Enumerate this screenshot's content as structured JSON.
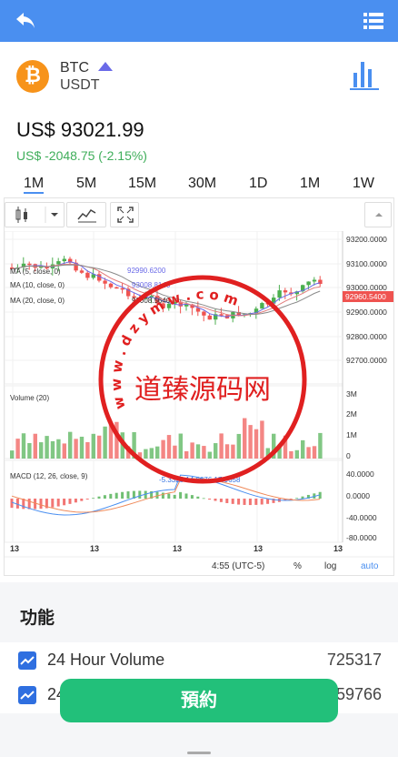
{
  "header": {
    "back_icon": "back-arrow-icon",
    "menu_icon": "list-icon",
    "color": "#4a8ff0"
  },
  "coin": {
    "logo": "₿",
    "symbol": "BTC",
    "quote": "USDT",
    "chart_icon": "bar-chart-icon"
  },
  "price": {
    "value": "US$ 93021.99",
    "change": "US$ -2048.75 (-2.15%)",
    "change_color": "#3fae5a"
  },
  "tabs": {
    "items": [
      "1M",
      "5M",
      "15M",
      "30M",
      "1D",
      "1M",
      "1W"
    ],
    "active": "1M"
  },
  "chart": {
    "price_axis": [
      "93200.0000",
      "93100.0000",
      "93000.0000",
      "92900.0000",
      "92800.0000",
      "92700.0000"
    ],
    "last_price": "92960.5400",
    "legend_ma5_value": "92990.6200",
    "legend_ma10_value": "93008.8140",
    "legend_ma20_value": "93008.5640",
    "legend_ma5": "MA (5, close, 0)",
    "legend_ma10": "MA (10, close, 0)",
    "legend_ma20": "MA (20, close, 0)",
    "volume_label": "Volume (20)",
    "volume_axis": [
      "3M",
      "2M",
      "1M",
      "0"
    ],
    "macd_label": "MACD (12, 26, close, 9)",
    "macd_values": "-5.3323  14.6676  17.9658",
    "macd_axis": [
      "40.0000",
      "0.0000",
      "-40.0000",
      "-80.0000"
    ],
    "time_ticks": [
      "13",
      "13",
      "13",
      "13",
      "13"
    ],
    "time_display": "4:55 (UTC-5)",
    "scale_percent": "%",
    "scale_log": "log",
    "scale_auto": "auto",
    "up_color": "#4caf50",
    "down_color": "#ef5350"
  },
  "watermark": {
    "text": "道臻源码网",
    "ring_text": "w w w . d z y m w . c o m",
    "color": "#e02020"
  },
  "functions": {
    "title": "功能",
    "rows": [
      {
        "label": "24 Hour Volume",
        "value": "725317"
      },
      {
        "label": "24",
        "value": "59766"
      }
    ]
  },
  "reserve_button": {
    "label": "預約"
  }
}
